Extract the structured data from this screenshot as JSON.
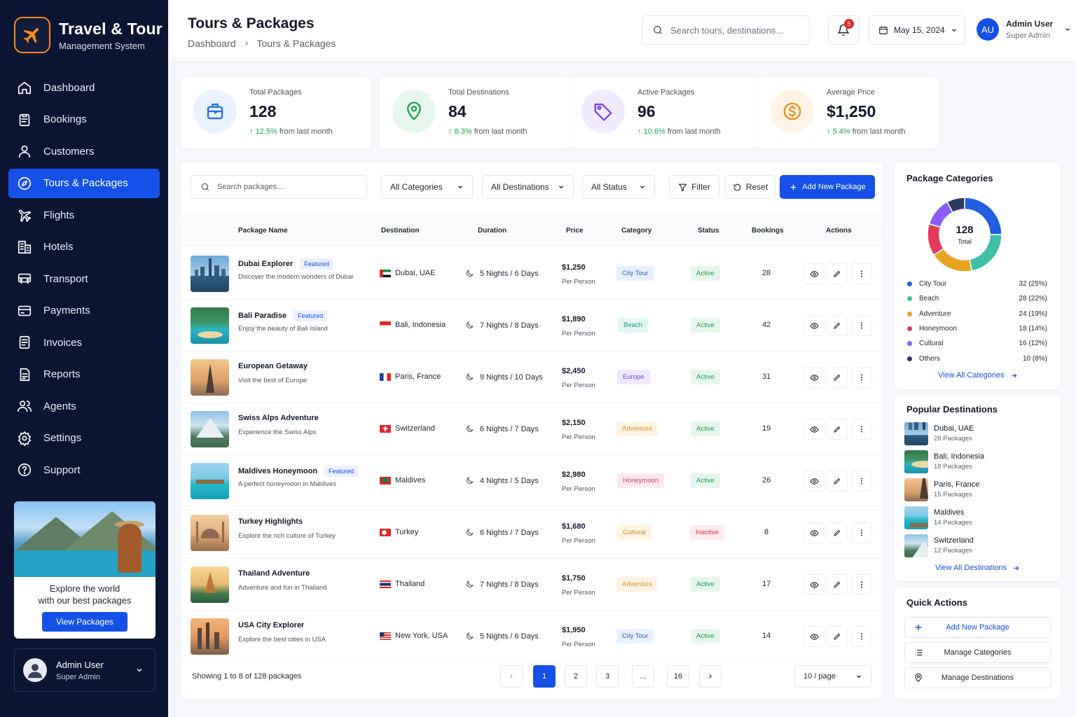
{
  "brand": {
    "title": "Travel & Tour",
    "subtitle": "Management System"
  },
  "nav": [
    {
      "label": "Dashboard",
      "icon": "home-icon"
    },
    {
      "label": "Bookings",
      "icon": "clipboard-icon"
    },
    {
      "label": "Customers",
      "icon": "user-icon"
    },
    {
      "label": "Tours & Packages",
      "icon": "compass-icon",
      "active": true
    },
    {
      "label": "Flights",
      "icon": "plane-icon"
    },
    {
      "label": "Hotels",
      "icon": "building-icon"
    },
    {
      "label": "Transport",
      "icon": "bus-icon"
    },
    {
      "label": "Payments",
      "icon": "payment-icon"
    },
    {
      "label": "Invoices",
      "icon": "invoice-icon"
    },
    {
      "label": "Reports",
      "icon": "report-icon"
    },
    {
      "label": "Agents",
      "icon": "users-icon"
    },
    {
      "label": "Settings",
      "icon": "gear-icon"
    },
    {
      "label": "Support",
      "icon": "help-icon"
    }
  ],
  "promo": {
    "line1": "Explore the world",
    "line2": "with our best packages",
    "button": "View Packages"
  },
  "sidebar_user": {
    "name": "Admin User",
    "role": "Super Admin"
  },
  "header": {
    "title": "Tours & Packages",
    "breadcrumb": [
      "Dashboard",
      "Tours & Packages"
    ],
    "search_placeholder": "Search tours, destinations...",
    "notif_count": "5",
    "date": "May 15, 2024",
    "user_initials": "AU",
    "user_name": "Admin User",
    "user_role": "Super Admin"
  },
  "stats": [
    {
      "label": "Total Packages",
      "value": "128",
      "change": "12.5%",
      "suffix": "from last month",
      "color": "#1f6feb",
      "bg": "#eaf1ff"
    },
    {
      "label": "Total Destinations",
      "value": "84",
      "change": "8.3%",
      "suffix": "from last month",
      "color": "#17a34a",
      "bg": "#e8f7ee"
    },
    {
      "label": "Active Packages",
      "value": "96",
      "change": "10.6%",
      "suffix": "from last month",
      "color": "#7c3aed",
      "bg": "#f1ebff"
    },
    {
      "label": "Average Price",
      "value": "$1,250",
      "change": "5.4%",
      "suffix": "from last month",
      "color": "#f08a16",
      "bg": "#fff3e6"
    }
  ],
  "filters": {
    "search_placeholder": "Search packages...",
    "categories": "All Categories",
    "destinations": "All Destinations",
    "status": "All Status",
    "filter": "Filter",
    "reset": "Reset",
    "add": "Add New Package"
  },
  "table": {
    "headers": [
      "Package Name",
      "Destination",
      "Duration",
      "Price",
      "Category",
      "Status",
      "Bookings",
      "Actions"
    ],
    "rows": [
      {
        "name": "Dubai Explorer",
        "featured": "Featured",
        "desc": "Discover the modern wonders of Dubai",
        "dest": "Dubai, UAE",
        "flag": "uae",
        "duration": "5 Nights / 6 Days",
        "price": "$1,250",
        "per": "Per Person",
        "category": "City Tour",
        "cat_type": "city",
        "status": "Active",
        "bookings": "28",
        "thumb": "city"
      },
      {
        "name": "Bali Paradise",
        "featured": "Featured",
        "desc": "Enjoy the beauty of Bali Island",
        "dest": "Bali, Indonesia",
        "flag": "indonesia",
        "duration": "7 Nights / 8 Days",
        "price": "$1,890",
        "per": "Per Person",
        "category": "Beach",
        "cat_type": "beach",
        "status": "Active",
        "bookings": "42",
        "thumb": "beach"
      },
      {
        "name": "European Getaway",
        "featured": "",
        "desc": "Visit the best of Europe",
        "dest": "Paris, France",
        "flag": "france",
        "duration": "9 Nights / 10 Days",
        "price": "$2,450",
        "per": "Per Person",
        "category": "Europe",
        "cat_type": "europe",
        "status": "Active",
        "bookings": "31",
        "thumb": "paris"
      },
      {
        "name": "Swiss Alps Adventure",
        "featured": "",
        "desc": "Experience the Swiss Alps",
        "dest": "Switzerland",
        "flag": "swiss",
        "duration": "6 Nights / 7 Days",
        "price": "$2,150",
        "per": "Per Person",
        "category": "Adventure",
        "cat_type": "adventure",
        "status": "Active",
        "bookings": "19",
        "thumb": "alps"
      },
      {
        "name": "Maldives Honeymoon",
        "featured": "Featured",
        "desc": "A perfect honeymoon in Maldives",
        "dest": "Maldives",
        "flag": "maldives",
        "duration": "4 Nights / 5 Days",
        "price": "$2,980",
        "per": "Per Person",
        "category": "Honeymoon",
        "cat_type": "honeymoon",
        "status": "Active",
        "bookings": "26",
        "thumb": "maldives"
      },
      {
        "name": "Turkey Highlights",
        "featured": "",
        "desc": "Explore the rich culture of Turkey",
        "dest": "Turkey",
        "flag": "turkey",
        "duration": "6 Nights / 7 Days",
        "price": "$1,680",
        "per": "Per Person",
        "category": "Cultural",
        "cat_type": "cultural",
        "status": "Inactive",
        "bookings": "8",
        "thumb": "turkey"
      },
      {
        "name": "Thailand Adventure",
        "featured": "",
        "desc": "Adventure and fun in Thailand",
        "dest": "Thailand",
        "flag": "thailand",
        "duration": "7 Nights / 8 Days",
        "price": "$1,750",
        "per": "Per Person",
        "category": "Adventure",
        "cat_type": "adventure",
        "status": "Active",
        "bookings": "17",
        "thumb": "thailand"
      },
      {
        "name": "USA City Explorer",
        "featured": "",
        "desc": "Explore the best cities in USA",
        "dest": "New York, USA",
        "flag": "usa",
        "duration": "5 Nights / 6 Days",
        "price": "$1,950",
        "per": "Per Person",
        "category": "City Tour",
        "cat_type": "city",
        "status": "Active",
        "bookings": "14",
        "thumb": "nyc"
      }
    ]
  },
  "pagination": {
    "showing": "Showing 1 to 8 of 128 packages",
    "pages": [
      "1",
      "2",
      "3",
      "...",
      "16"
    ],
    "per_page": "10 / page"
  },
  "categories_panel": {
    "title": "Package Categories",
    "total_value": "128",
    "total_label": "Total",
    "items": [
      {
        "name": "City Tour",
        "value": "32 (25%)",
        "count": 32,
        "color": "#1f5fe0"
      },
      {
        "name": "Beach",
        "value": "28 (22%)",
        "count": 28,
        "color": "#3fbfa6"
      },
      {
        "name": "Adventure",
        "value": "24 (19%)",
        "count": 24,
        "color": "#e8a320"
      },
      {
        "name": "Honeymoon",
        "value": "18 (14%)",
        "count": 18,
        "color": "#e23b5a"
      },
      {
        "name": "Cultural",
        "value": "16 (12%)",
        "count": 16,
        "color": "#8b5cf6"
      },
      {
        "name": "Others",
        "value": "10 (8%)",
        "count": 10,
        "color": "#2e3a66"
      }
    ],
    "link": "View All Categories"
  },
  "popular": {
    "title": "Popular Destinations",
    "items": [
      {
        "name": "Dubai, UAE",
        "count": "28 Packages",
        "thumb": "city"
      },
      {
        "name": "Bali, Indonesia",
        "count": "18 Packages",
        "thumb": "beach"
      },
      {
        "name": "Paris, France",
        "count": "15 Packages",
        "thumb": "paris"
      },
      {
        "name": "Maldives",
        "count": "14 Packages",
        "thumb": "maldives"
      },
      {
        "name": "Switzerland",
        "count": "12 Packages",
        "thumb": "alps"
      }
    ],
    "link": "View All Destinations"
  },
  "quick_actions": {
    "title": "Quick Actions",
    "items": [
      "Add New Package",
      "Manage Categories",
      "Manage Destinations"
    ]
  },
  "colors": {
    "primary": "#1550e8",
    "sidebar": "#0b1533",
    "success": "#17a34a"
  }
}
